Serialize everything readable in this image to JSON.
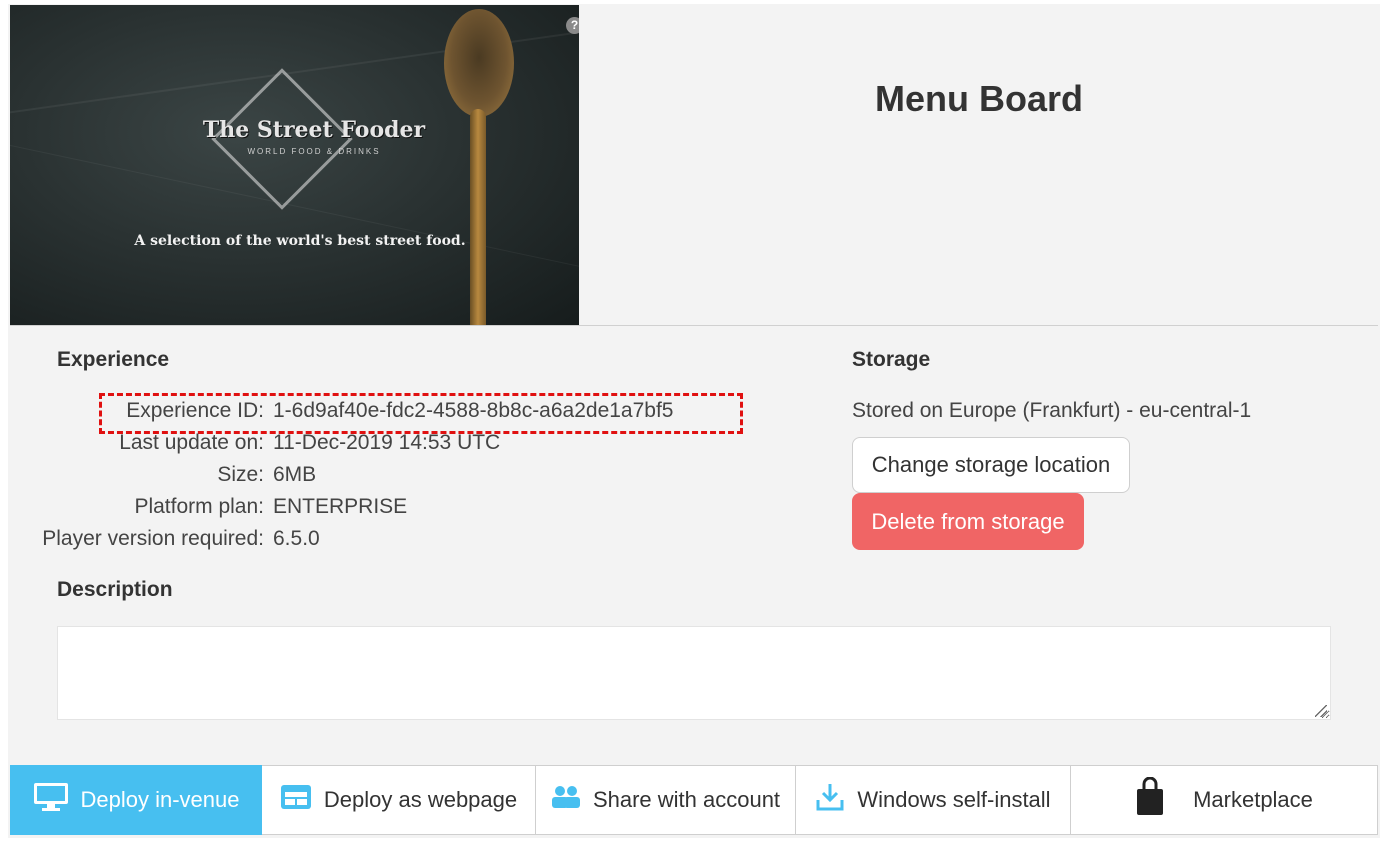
{
  "app": {
    "title": "Menu Board",
    "help_glyph": "?"
  },
  "thumbnail": {
    "brand": "The Street Fooder",
    "tagline": "WORLD FOOD & DRINKS",
    "caption": "A selection of the world's best street food."
  },
  "experience": {
    "heading": "Experience",
    "rows": [
      {
        "label": "Experience ID:",
        "value": "1-6d9af40e-fdc2-4588-8b8c-a6a2de1a7bf5"
      },
      {
        "label": "Last update on:",
        "value": "11-Dec-2019 14:53 UTC"
      },
      {
        "label": "Size:",
        "value": "6MB"
      },
      {
        "label": "Platform plan:",
        "value": "ENTERPRISE"
      },
      {
        "label": "Player version required:",
        "value": "6.5.0"
      }
    ]
  },
  "storage": {
    "heading": "Storage",
    "location": "Stored on Europe (Frankfurt) - eu-central-1",
    "change_label": "Change storage location",
    "delete_label": "Delete from storage"
  },
  "description": {
    "heading": "Description",
    "value": ""
  },
  "tabs": [
    {
      "label": "Deploy in-venue",
      "icon": "monitor-icon",
      "active": true
    },
    {
      "label": "Deploy as webpage",
      "icon": "browser-window-icon",
      "active": false
    },
    {
      "label": "Share with account",
      "icon": "users-icon",
      "active": false
    },
    {
      "label": "Windows self-install",
      "icon": "download-icon",
      "active": false
    },
    {
      "label": "Marketplace",
      "icon": "shopping-bag-icon",
      "active": false
    }
  ],
  "colors": {
    "accent": "#47bff0",
    "danger": "#f06565",
    "highlight": "#e01010"
  }
}
